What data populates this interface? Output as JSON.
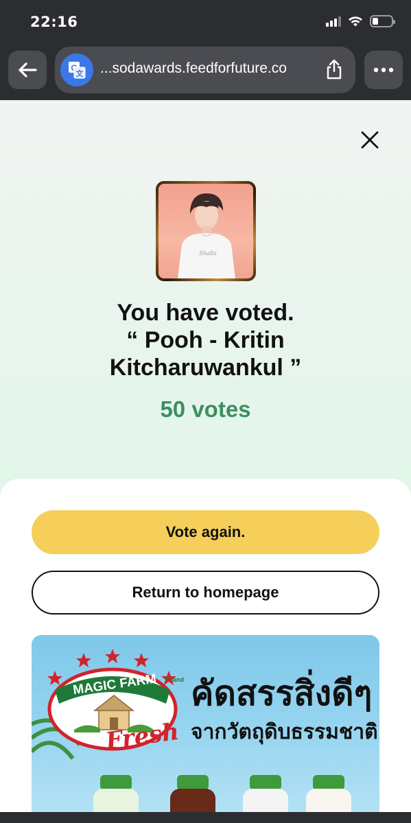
{
  "status": {
    "time": "22:16"
  },
  "browser": {
    "url": "...sodawards.feedforfuture.co",
    "back_icon": "back-arrow-icon",
    "translate_icon": "google-translate-icon",
    "share_icon": "share-icon",
    "more_icon": "more-dots-icon"
  },
  "result": {
    "line1": "You have voted.",
    "line2": "“ Pooh - Kritin",
    "line3": "Kitcharuwankul ”",
    "votes": "50 votes"
  },
  "actions": {
    "vote_again": "Vote again.",
    "return_home": "Return to homepage"
  },
  "ad": {
    "brand": "MAGIC FARM",
    "brand_sub": "Brand",
    "tagline": "Fresh",
    "headline": "คัดสรรสิ่งดีๆ",
    "subline": "จากวัตถุดิบธรรมชาติ"
  },
  "colors": {
    "accent_green": "#3c8f61",
    "vote_button": "#f5cf59",
    "chrome": "#2b2d31"
  }
}
